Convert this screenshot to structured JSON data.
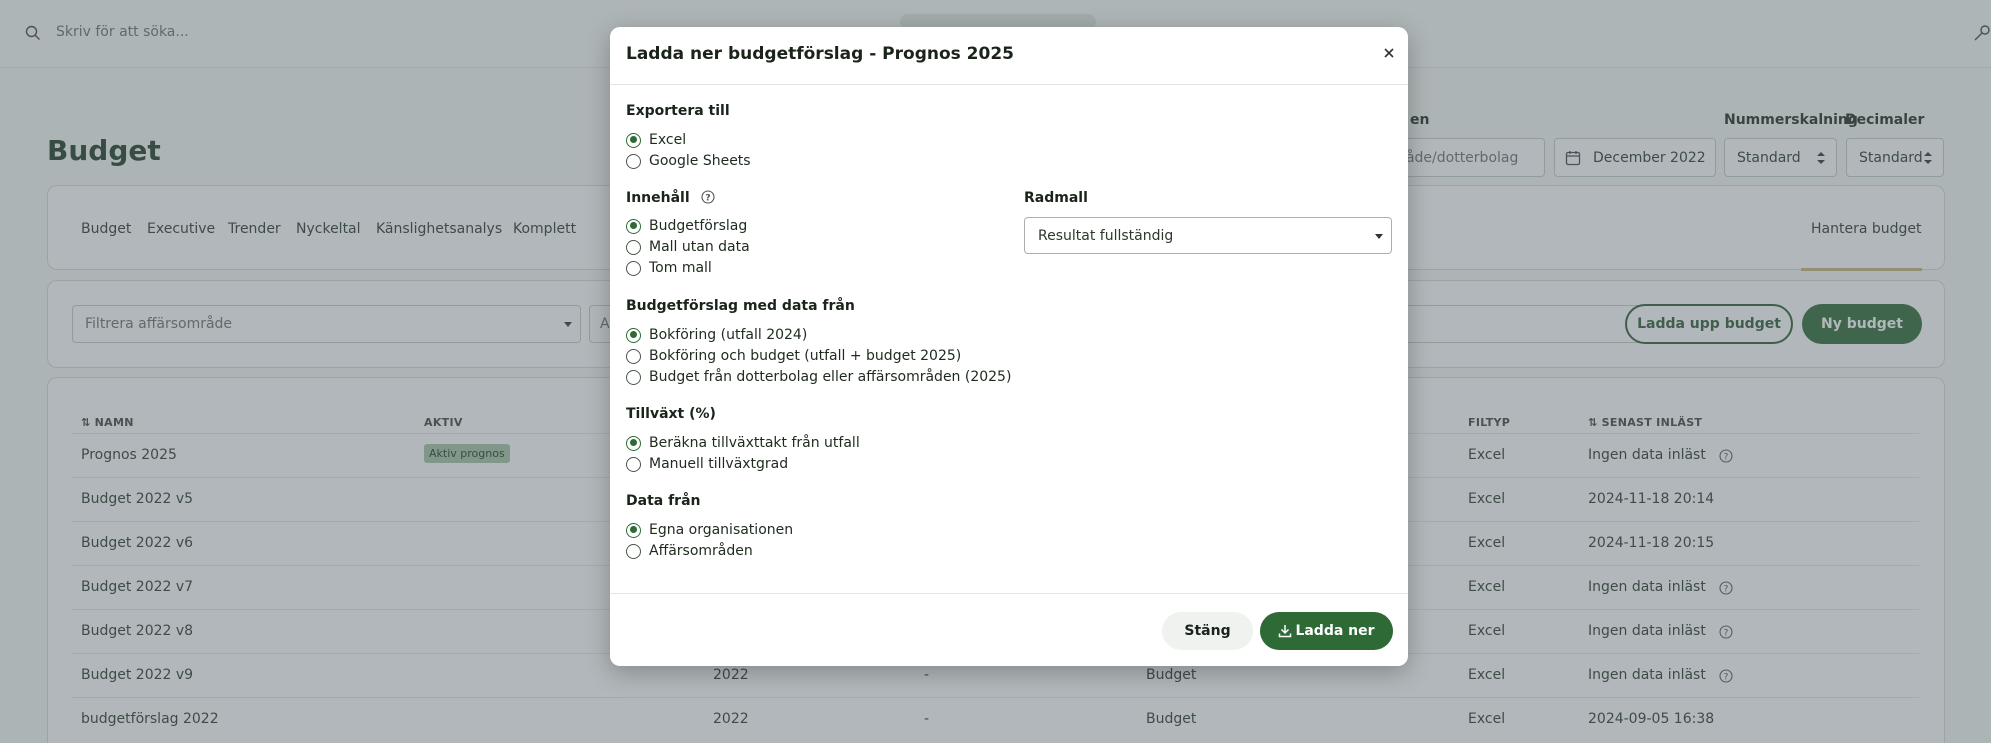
{
  "topbar": {
    "search_placeholder": "Skriv för att söka..."
  },
  "page": {
    "title": "Budget"
  },
  "controls": {
    "org_value": "område/dotterbolag",
    "period_label": "December 2022",
    "scaling_label": "Nummerskalning",
    "scaling_value": "Standard",
    "decimals_label": "Decimaler",
    "decimals_value": "Standard",
    "org_label_fragment": "en"
  },
  "tabs": [
    "Budget",
    "Executive",
    "Trender",
    "Nyckeltal",
    "Känslighetsanalys",
    "Komplett"
  ],
  "manage_tab": "Hantera budget",
  "filter": {
    "placeholder": "Filtrera affärsområde",
    "second_fragment": "A",
    "upload_button": "Ladda upp budget",
    "new_button": "Ny budget"
  },
  "table": {
    "headers": {
      "name": "NAMN",
      "active": "AKTIV",
      "filetype": "FILTYP",
      "last_loaded": "SENAST INLÄST"
    },
    "rows": [
      {
        "name": "Prognos 2025",
        "badge": "Aktiv prognos",
        "year": "",
        "dash": "",
        "type": "",
        "filetype": "Excel",
        "last": "Ingen data inläst"
      },
      {
        "name": "Budget 2022 v5",
        "badge": "",
        "year": "",
        "dash": "",
        "type": "",
        "filetype": "Excel",
        "last": "2024-11-18 20:14"
      },
      {
        "name": "Budget 2022 v6",
        "badge": "",
        "year": "",
        "dash": "",
        "type": "",
        "filetype": "Excel",
        "last": "2024-11-18 20:15"
      },
      {
        "name": "Budget 2022 v7",
        "badge": "",
        "year": "",
        "dash": "",
        "type": "",
        "filetype": "Excel",
        "last": "Ingen data inläst"
      },
      {
        "name": "Budget 2022 v8",
        "badge": "",
        "year": "",
        "dash": "",
        "type": "",
        "filetype": "Excel",
        "last": "Ingen data inläst"
      },
      {
        "name": "Budget 2022 v9",
        "badge": "",
        "year": "2022",
        "dash": "-",
        "type": "Budget",
        "filetype": "Excel",
        "last": "Ingen data inläst"
      },
      {
        "name": "budgetförslag 2022",
        "badge": "",
        "year": "2022",
        "dash": "-",
        "type": "Budget",
        "filetype": "Excel",
        "last": "2024-09-05 16:38"
      }
    ]
  },
  "modal": {
    "title": "Ladda ner budgetförslag - Prognos 2025",
    "export_label": "Exportera till",
    "export_options": [
      "Excel",
      "Google Sheets"
    ],
    "content_label": "Innehåll",
    "content_options": [
      "Budgetförslag",
      "Mall utan data",
      "Tom mall"
    ],
    "radmall_label": "Radmall",
    "radmall_value": "Resultat fullständig",
    "source_label": "Budgetförslag med data från",
    "source_options": [
      "Bokföring (utfall 2024)",
      "Bokföring och budget (utfall + budget 2025)",
      "Budget från dotterbolag eller affärsområden (2025)"
    ],
    "growth_label": "Tillväxt (%)",
    "growth_options": [
      "Beräkna tillväxttakt från utfall",
      "Manuell tillväxtgrad"
    ],
    "datafrom_label": "Data från",
    "datafrom_options": [
      "Egna organisationen",
      "Affärsområden"
    ],
    "close_button": "Stäng",
    "download_button": "Ladda ner"
  },
  "colors": {
    "primary": "#2d6a35",
    "badge_bg": "#a7c4a6",
    "tab_underline": "#c9b47a"
  }
}
